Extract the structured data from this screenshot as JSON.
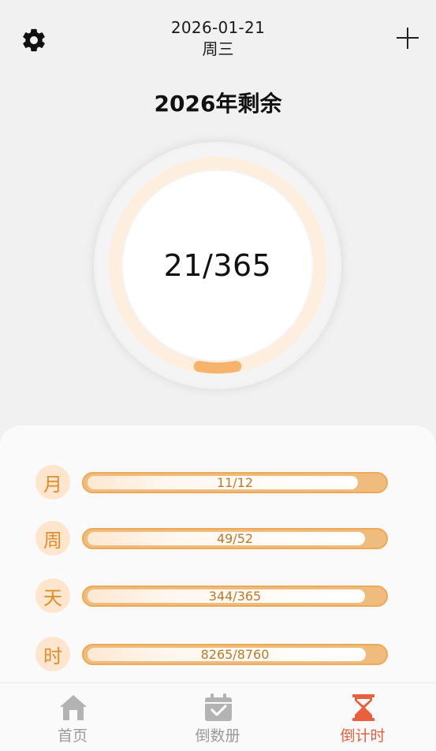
{
  "header": {
    "date": "2026-01-21",
    "weekday": "周三",
    "settings_icon": "gear-icon",
    "add_icon": "plus-icon"
  },
  "title": "2026年剩余",
  "ring": {
    "label": "21/365",
    "progress": 0.0575,
    "track_color": "#fdeedd",
    "progress_color": "#f5b36b"
  },
  "progress_rows": [
    {
      "unit": "月",
      "label": "11/12",
      "remaining_fraction": 0.9167
    },
    {
      "unit": "周",
      "label": "49/52",
      "remaining_fraction": 0.9423
    },
    {
      "unit": "天",
      "label": "344/365",
      "remaining_fraction": 0.9425
    },
    {
      "unit": "时",
      "label": "8265/8760",
      "remaining_fraction": 0.9435
    }
  ],
  "nav": {
    "items": [
      {
        "label": "首页",
        "icon": "home-icon",
        "active": false
      },
      {
        "label": "倒数册",
        "icon": "calendar-check-icon",
        "active": false
      },
      {
        "label": "倒计时",
        "icon": "hourglass-icon",
        "active": true
      }
    ],
    "active_color": "#e8603c",
    "inactive_color": "#9a9a9a"
  },
  "colors": {
    "accent": "#f0bc7d",
    "badge_bg": "#fde6cd",
    "badge_text": "#e08d2c"
  }
}
